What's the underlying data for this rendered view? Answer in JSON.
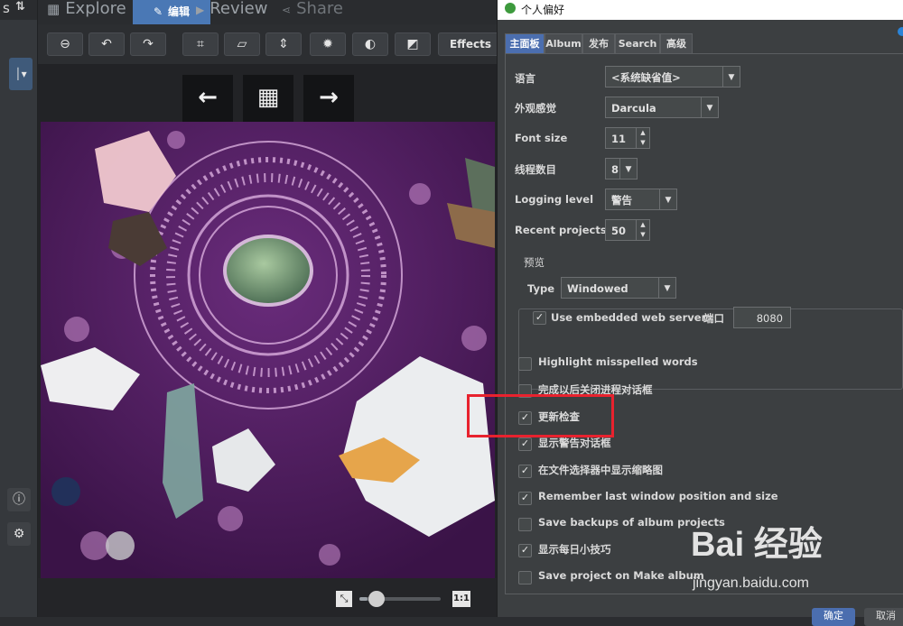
{
  "left_strip": {
    "top_label": "s",
    "sort_icon": "sort-arrows-icon",
    "dropdown_icon": "chevron-down-icon",
    "info_icon": "info-icon",
    "gear_icon": "gear-icon"
  },
  "main_tabs": [
    {
      "label": "Explore",
      "icon": "grid-icon"
    },
    {
      "label": "编辑",
      "icon": "pencil-icon"
    },
    {
      "label": "Review",
      "icon": "play-icon"
    },
    {
      "label": "Share",
      "icon": "share-icon"
    }
  ],
  "toolbar": {
    "effects_label": "Effects",
    "tools": [
      "minus-circle-icon",
      "rotate-left-icon",
      "rotate-right-icon",
      "crop-icon",
      "straighten-icon",
      "flip-icon",
      "settings-icon",
      "contrast-icon",
      "adjust-icon"
    ]
  },
  "nav": {
    "prev_icon": "arrow-left-icon",
    "grid_icon": "grid-icon",
    "next_icon": "arrow-right-icon"
  },
  "bottom": {
    "fit_icon": "fit-screen-icon",
    "zoom_level": 0.1,
    "actual_size_label": "1:1"
  },
  "dialog": {
    "title": "个人偏好",
    "tabs": [
      "主面板",
      "Album",
      "发布",
      "Search",
      "高级"
    ],
    "language_label": "语言",
    "language_value": "<系统缺省值>",
    "look_label": "外观感觉",
    "look_value": "Darcula",
    "font_size_label": "Font size",
    "font_size_value": "11",
    "threads_label": "线程数目",
    "threads_value": "8",
    "logging_label": "Logging level",
    "logging_value": "警告",
    "recent_label": "Recent projects",
    "recent_value": "50",
    "preview_group": "预览",
    "type_label": "Type",
    "type_value": "Windowed",
    "embedded_label": "Use embedded web server",
    "embedded_checked": true,
    "port_label": "端口",
    "port_value": "8080",
    "options": [
      {
        "label": "Highlight misspelled words",
        "checked": false
      },
      {
        "label": "完成以后关闭进程对话框",
        "checked": false
      },
      {
        "label": "更新检查",
        "checked": true
      },
      {
        "label": "显示警告对话框",
        "checked": true
      },
      {
        "label": "在文件选择器中显示缩略图",
        "checked": true
      },
      {
        "label": "Remember last window position and size",
        "checked": true
      },
      {
        "label": "Save backups of album projects",
        "checked": false
      },
      {
        "label": "显示每日小技巧",
        "checked": true
      },
      {
        "label": "Save project on Make album",
        "checked": false
      }
    ],
    "ok_label": "确定",
    "cancel_label": "取消"
  },
  "watermark": {
    "logo": "Bai 经验",
    "url": "jingyan.baidu.com"
  },
  "colors": {
    "accent": "#4b6eaf",
    "highlight_box": "#e8222e",
    "dialog_bg": "#3c3f41"
  }
}
